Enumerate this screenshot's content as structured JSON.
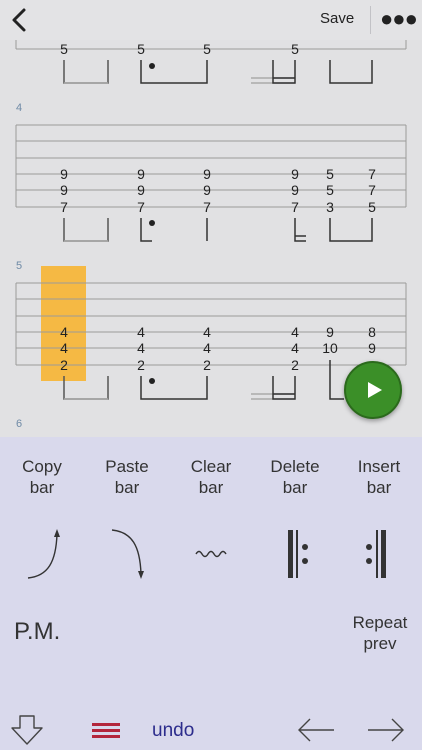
{
  "header": {
    "save_label": "Save"
  },
  "tab": {
    "colors": {
      "staff_line": "#9a9a9a",
      "note_text": "#222222",
      "measure_number": "#6f8aa6",
      "highlight": "#f5b944",
      "play_button": "#3b8f28"
    },
    "measures": [
      {
        "number": "",
        "columns": [
          {
            "label": "5"
          },
          {
            "label": "5"
          },
          {
            "label": "5"
          },
          {
            "label": "5"
          }
        ]
      },
      {
        "number": "4",
        "columns": [
          {
            "notes": [
              "9",
              "9",
              "7"
            ]
          },
          {
            "notes": [
              "9",
              "9",
              "7"
            ]
          },
          {
            "notes": [
              "9",
              "9",
              "7"
            ]
          },
          {
            "notes": [
              "9",
              "9",
              "7"
            ]
          },
          {
            "notes": [
              "5",
              "5",
              "3"
            ]
          },
          {
            "notes": [
              "7",
              "7",
              "5"
            ]
          }
        ]
      },
      {
        "number": "5",
        "columns": [
          {
            "notes": [
              "4",
              "4",
              "2"
            ]
          },
          {
            "notes": [
              "4",
              "4",
              "2"
            ]
          },
          {
            "notes": [
              "4",
              "4",
              "2"
            ]
          },
          {
            "notes": [
              "4",
              "4",
              "2"
            ]
          },
          {
            "notes": [
              "9",
              "10",
              ""
            ]
          },
          {
            "notes": [
              "8",
              "9",
              ""
            ]
          }
        ]
      },
      {
        "number": "6"
      }
    ]
  },
  "panel": {
    "row1": [
      {
        "label_l1": "Copy",
        "label_l2": "bar"
      },
      {
        "label_l1": "Paste",
        "label_l2": "bar"
      },
      {
        "label_l1": "Clear",
        "label_l2": "bar"
      },
      {
        "label_l1": "Delete",
        "label_l2": "bar"
      },
      {
        "label_l1": "Insert",
        "label_l2": "bar"
      }
    ],
    "icons": [
      "bend-up-icon",
      "bend-down-icon",
      "vibrato-icon",
      "repeat-start-icon",
      "repeat-end-icon"
    ],
    "pm_label": "P.M.",
    "repeat_prev_l1": "Repeat",
    "repeat_prev_l2": "prev",
    "undo_label": "undo",
    "bottom_icons": [
      "collapse-down-icon",
      "menu-lines-icon",
      "arrow-left-icon",
      "arrow-right-icon"
    ]
  }
}
